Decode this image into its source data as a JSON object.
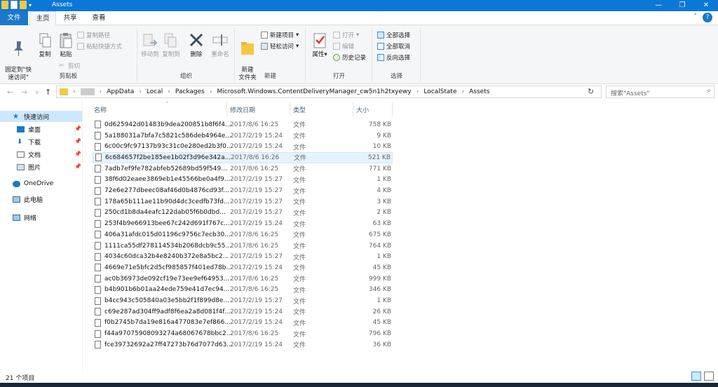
{
  "window": {
    "title": "Assets"
  },
  "quick_access_toolbar": [
    "folder-icon",
    "properties-check-icon",
    "new-folder-icon",
    "customize-dropdown-icon"
  ],
  "window_controls": {
    "minimize": "—",
    "maximize": "❐",
    "close": "✕"
  },
  "tabs": [
    "文件",
    "主页",
    "共享",
    "查看"
  ],
  "ribbon": {
    "clipboard": {
      "pin": "固定到\"快\n速访问\"",
      "copy": "复制",
      "paste": "粘贴",
      "copy_path": "复制路径",
      "paste_shortcut": "粘贴快捷方式",
      "cut": "剪切",
      "label": "剪贴板"
    },
    "organize": {
      "move_to": "移动到",
      "copy_to": "复制到",
      "delete": "删除",
      "rename": "重命名",
      "label": "组织"
    },
    "new": {
      "new_folder": "新建\n文件夹",
      "new_item": "新建项目",
      "easy_access": "轻松访问",
      "label": "新建"
    },
    "open": {
      "properties": "属性",
      "open": "打开",
      "edit": "编辑",
      "history": "历史记录",
      "label": "打开"
    },
    "select": {
      "select_all": "全部选择",
      "select_none": "全部取消",
      "invert": "反向选择",
      "label": "选择"
    }
  },
  "address": {
    "segments": [
      "AppData",
      "Local",
      "Packages",
      "Microsoft.Windows.ContentDeliveryManager_cw5n1h2txyewy",
      "LocalState",
      "Assets"
    ],
    "search_placeholder": "搜索\"Assets\""
  },
  "nav": {
    "items": [
      {
        "label": "快速访问",
        "icon": "star-icon"
      },
      {
        "label": "桌面",
        "icon": "desktop-icon"
      },
      {
        "label": "下载",
        "icon": "download-icon"
      },
      {
        "label": "文档",
        "icon": "document-icon"
      },
      {
        "label": "图片",
        "icon": "pictures-icon"
      },
      {
        "label": "OneDrive",
        "icon": "cloud-icon"
      },
      {
        "label": "此电脑",
        "icon": "computer-icon"
      },
      {
        "label": "网络",
        "icon": "network-icon"
      }
    ]
  },
  "columns": {
    "name": "名称",
    "date": "修改日期",
    "type": "类型",
    "size": "大小"
  },
  "files": [
    {
      "name": "0d625942d01483b9dea200851b8f6f4...",
      "date": "2017/8/6 16:25",
      "type": "文件",
      "size": "758 KB"
    },
    {
      "name": "5a188031a7bfa7c5821c586deb4964e...",
      "date": "2017/2/19 15:24",
      "type": "文件",
      "size": "9 KB"
    },
    {
      "name": "6c00c9fc97137b93c31c0e280ed2b3f0...",
      "date": "2017/2/19 15:24",
      "type": "文件",
      "size": "10 KB"
    },
    {
      "name": "6c684657f2be185ee1b02f3d96e342a...",
      "date": "2017/8/6 16:26",
      "type": "文件",
      "size": "521 KB"
    },
    {
      "name": "7adb7ef9fe782abfeb52689bd59f549...",
      "date": "2017/8/6 16:25",
      "type": "文件",
      "size": "771 KB"
    },
    {
      "name": "38f6d02eaee3869eb1e45566be0a4f9...",
      "date": "2017/2/19 15:27",
      "type": "文件",
      "size": "1 KB"
    },
    {
      "name": "72e6e277dbeec08af46d0b4876cd93f...",
      "date": "2017/2/19 15:27",
      "type": "文件",
      "size": "4 KB"
    },
    {
      "name": "178a65b111ae11b90d4dc3cedfb73fd...",
      "date": "2017/2/19 15:27",
      "type": "文件",
      "size": "3 KB"
    },
    {
      "name": "250cd1b8da4eafc122dab05f6b0dbd...",
      "date": "2017/2/19 15:27",
      "type": "文件",
      "size": "2 KB"
    },
    {
      "name": "253f4b9e66913bee67c242d691f767c...",
      "date": "2017/2/19 15:24",
      "type": "文件",
      "size": "63 KB"
    },
    {
      "name": "406a31afdc015d01196c9756c7ecb30...",
      "date": "2017/8/6 16:25",
      "type": "文件",
      "size": "675 KB"
    },
    {
      "name": "1111ca55df278114534b2068dcb9c55...",
      "date": "2017/8/6 16:25",
      "type": "文件",
      "size": "764 KB"
    },
    {
      "name": "4034c60dca32b4e8240b372e8a5bc2...",
      "date": "2017/2/19 15:27",
      "type": "文件",
      "size": "1 KB"
    },
    {
      "name": "4669e71e5bfc2d5cf985857f401ed78b...",
      "date": "2017/2/19 15:24",
      "type": "文件",
      "size": "45 KB"
    },
    {
      "name": "ac0b36973de092cf19e73ee9ef64953...",
      "date": "2017/8/6 16:25",
      "type": "文件",
      "size": "999 KB"
    },
    {
      "name": "b4b901b6b01aa24ede759e41d7ec94...",
      "date": "2017/8/6 16:25",
      "type": "文件",
      "size": "346 KB"
    },
    {
      "name": "b4cc943c505840a03e5bb2f1f899d8e...",
      "date": "2017/2/19 15:27",
      "type": "文件",
      "size": "1 KB"
    },
    {
      "name": "c69e287ad304ff9adf8f6ea2a8d081f4f...",
      "date": "2017/2/19 15:24",
      "type": "文件",
      "size": "26 KB"
    },
    {
      "name": "f0b2745b7da19e816a477083e7ef866...",
      "date": "2017/2/19 15:24",
      "type": "文件",
      "size": "45 KB"
    },
    {
      "name": "f44a97075908093274a68067678bbc2...",
      "date": "2017/8/6 16:25",
      "type": "文件",
      "size": "796 KB"
    },
    {
      "name": "fce39732692a27ff47273b76d7077d63...",
      "date": "2017/2/19 15:24",
      "type": "文件",
      "size": "36 KB"
    }
  ],
  "status": {
    "count": "21 个项目"
  },
  "colors": {
    "accent": "#0b78d7",
    "selection": "#cce8ff"
  }
}
